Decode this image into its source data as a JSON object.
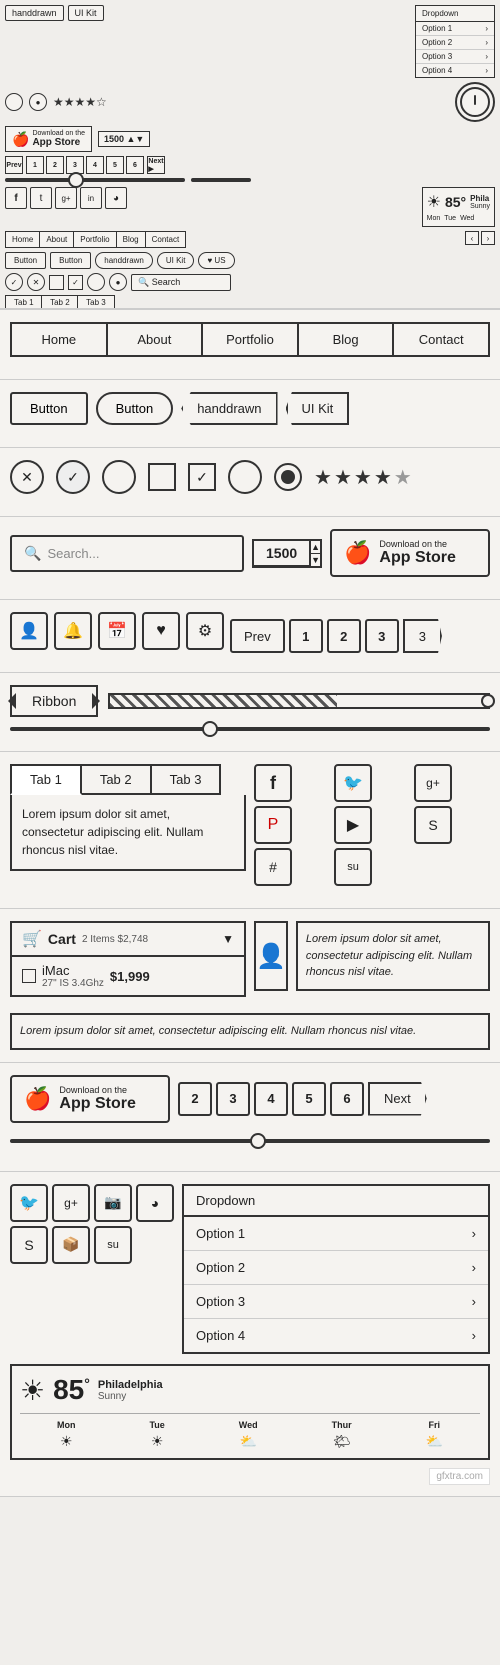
{
  "overview": {
    "tags": [
      "handdrawn",
      "UI Kit"
    ],
    "labels": [
      "Dropdown",
      "Option 1",
      "Option 2",
      "Option 3",
      "Option 4"
    ]
  },
  "nav": {
    "items": [
      "Home",
      "About",
      "Portfolio",
      "Blog",
      "Contact"
    ]
  },
  "buttons": {
    "btn1": "Button",
    "btn2": "Button",
    "btn3": "handdrawn",
    "btn4": "UI Kit"
  },
  "search": {
    "placeholder": "Search...",
    "number_value": "1500"
  },
  "appstore": {
    "line1": "Download on the",
    "line2": "App Store"
  },
  "icons": {
    "user": "👤",
    "bell": "🔔",
    "calendar": "📅",
    "heart": "♥",
    "gear": "⚙",
    "facebook": "f",
    "twitter": "t",
    "googleplus": "g+",
    "instagram": "in",
    "dribbble": "◕",
    "pinterest": "p",
    "play": "▶",
    "skype": "s",
    "hashtag": "#",
    "stumble": "su"
  },
  "pagination": {
    "prev": "Prev",
    "pages": [
      "1",
      "2",
      "3",
      "4",
      "5",
      "6"
    ],
    "next": "Next"
  },
  "ribbon": {
    "label": "Ribbon"
  },
  "tabs": {
    "items": [
      "Tab 1",
      "Tab 2",
      "Tab 3"
    ],
    "active": 0,
    "content": "Lorem ipsum dolor sit amet, consectetur adipiscing elit. Nullam rhoncus nisl vitae."
  },
  "cart": {
    "title": "Cart",
    "subtitle": "2 Items $2,748",
    "items": [
      {
        "name": "iMac",
        "spec": "27\" IS 3.4Ghz",
        "price": "$1,999"
      }
    ]
  },
  "text_blocks": {
    "block1": "Lorem ipsum dolor sit amet, consectetur adipiscing elit. Nullam rhoncus nisl vitae.",
    "block2": "Lorem ipsum dolor sit amet, consectetur adipiscing elit."
  },
  "dropdown": {
    "header": "Dropdown",
    "items": [
      "Option 1",
      "Option 2",
      "Option 3",
      "Option 4"
    ]
  },
  "weather": {
    "temp": "85",
    "degree": "°",
    "city": "Philadelphia",
    "desc": "Sunny",
    "days": [
      "Mon",
      "Tue",
      "Wed",
      "Thur",
      "Fri"
    ],
    "icons": [
      "☀",
      "☀",
      "⛅",
      "🌤",
      "⛅"
    ]
  },
  "stars": {
    "filled": 4,
    "half": 1
  }
}
